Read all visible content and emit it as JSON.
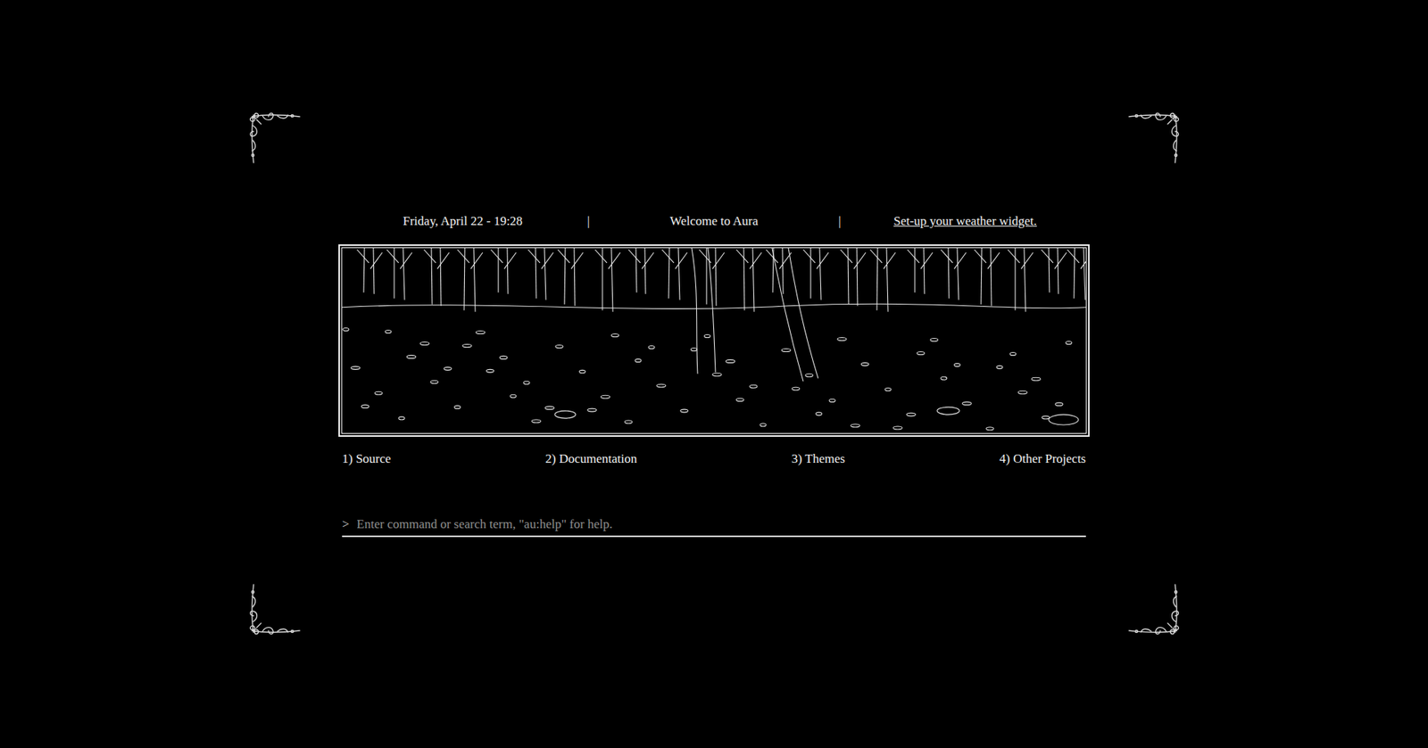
{
  "header": {
    "date": "Friday, April 22 - 19:28",
    "separators": [
      "|",
      "|"
    ],
    "welcome": "Welcome to Aura",
    "weather_link": "Set-up your weather widget."
  },
  "links": [
    {
      "label": "1) Source"
    },
    {
      "label": "2) Documentation"
    },
    {
      "label": "3) Themes"
    },
    {
      "label": "4) Other Projects"
    }
  ],
  "command": {
    "prompt": ">",
    "placeholder": "Enter command or search term, \"au:help\" for help."
  }
}
